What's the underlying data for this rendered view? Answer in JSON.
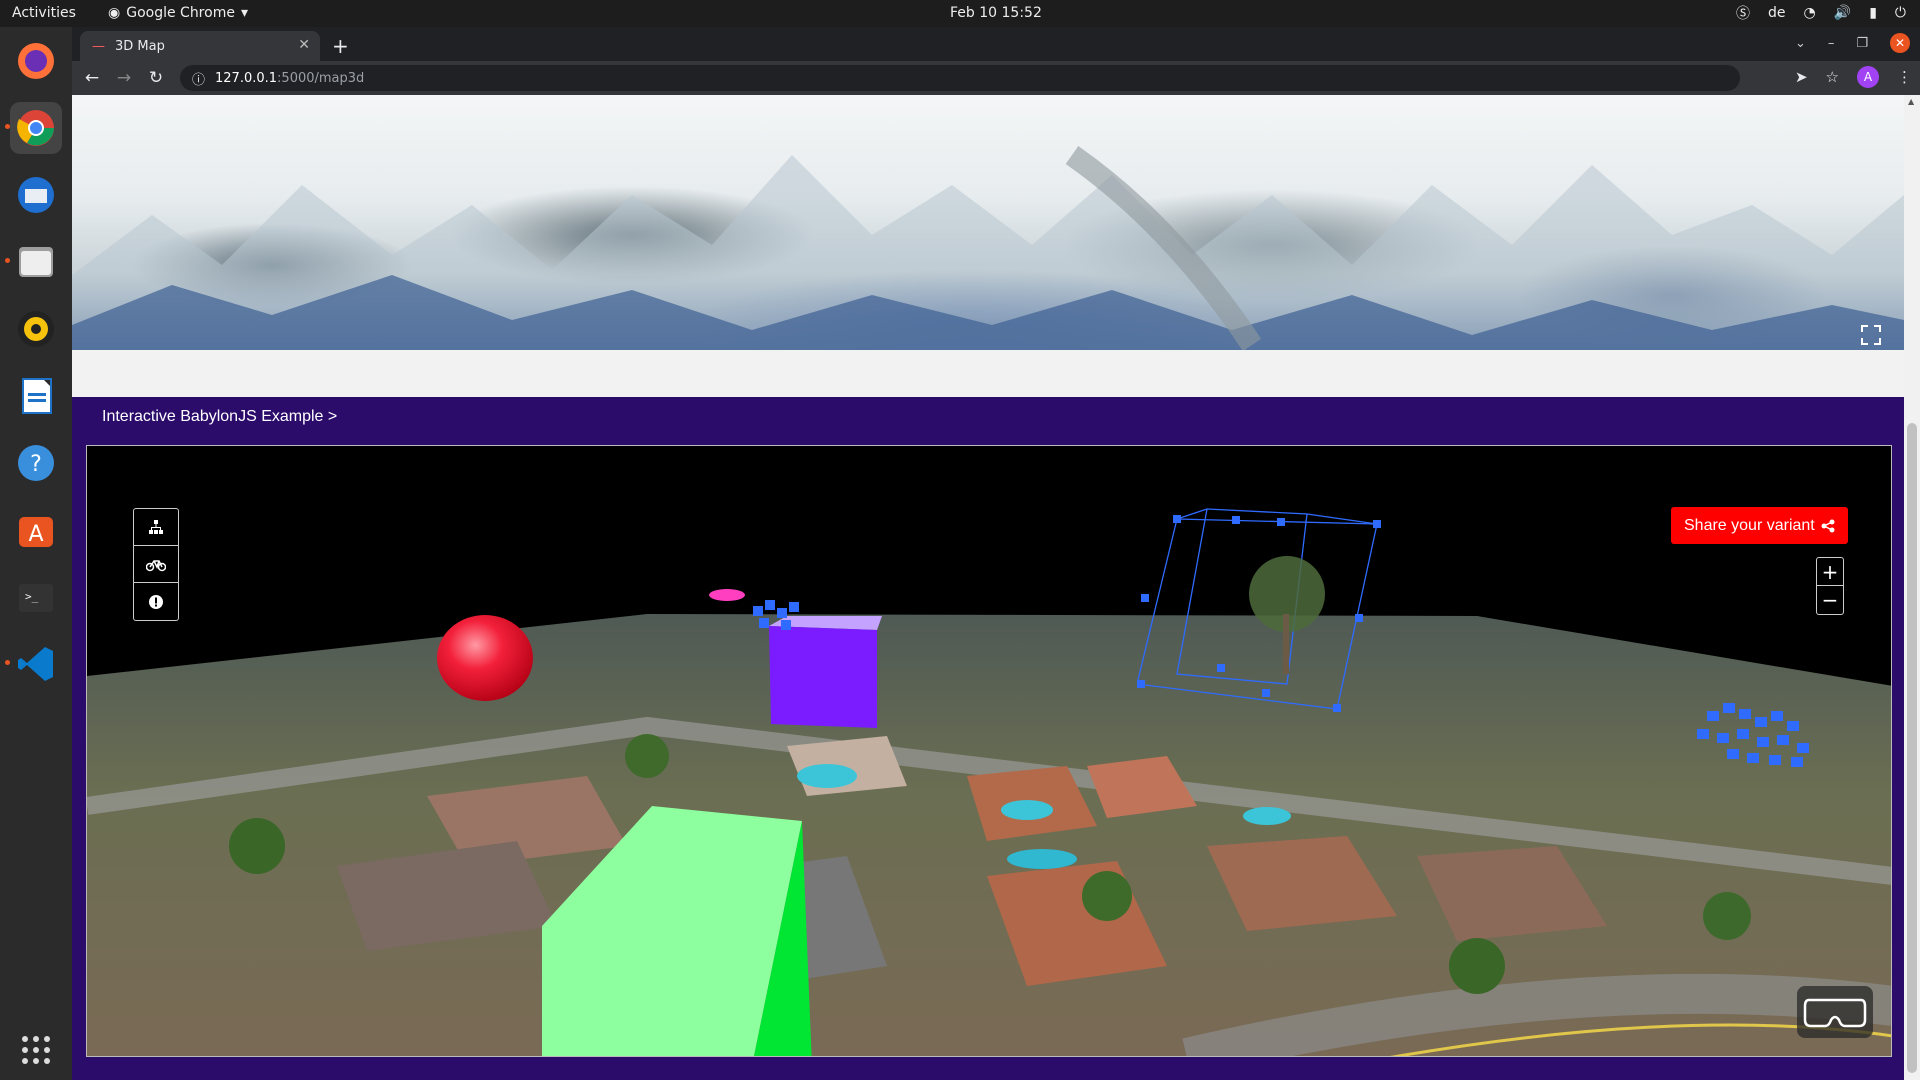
{
  "system": {
    "activities": "Activities",
    "app_name": "Google Chrome",
    "clock": "Feb 10  15:52",
    "keyboard_layout": "de"
  },
  "browser": {
    "tab_title": "3D Map",
    "url_host": "127.0.0.1",
    "url_path": ":5000/map3d",
    "profile_initial": "A"
  },
  "page": {
    "breadcrumb": "Interactive BabylonJS Example >",
    "share_button": "Share your variant",
    "zoom_in": "+",
    "zoom_out": "−"
  },
  "colors": {
    "accent_red": "#ff0000",
    "banner_purple": "#2b0c6b",
    "cube_purple": "#7a1cff",
    "cube_green": "#7dff9a",
    "sphere_red": "#e8102a",
    "gizmo_blue": "#2f6bff"
  },
  "icons": {
    "tools": [
      "sitemap-icon",
      "bicycle-icon",
      "info-icon"
    ],
    "fullscreen": "expand-icon",
    "vr": "vr-headset-icon"
  }
}
